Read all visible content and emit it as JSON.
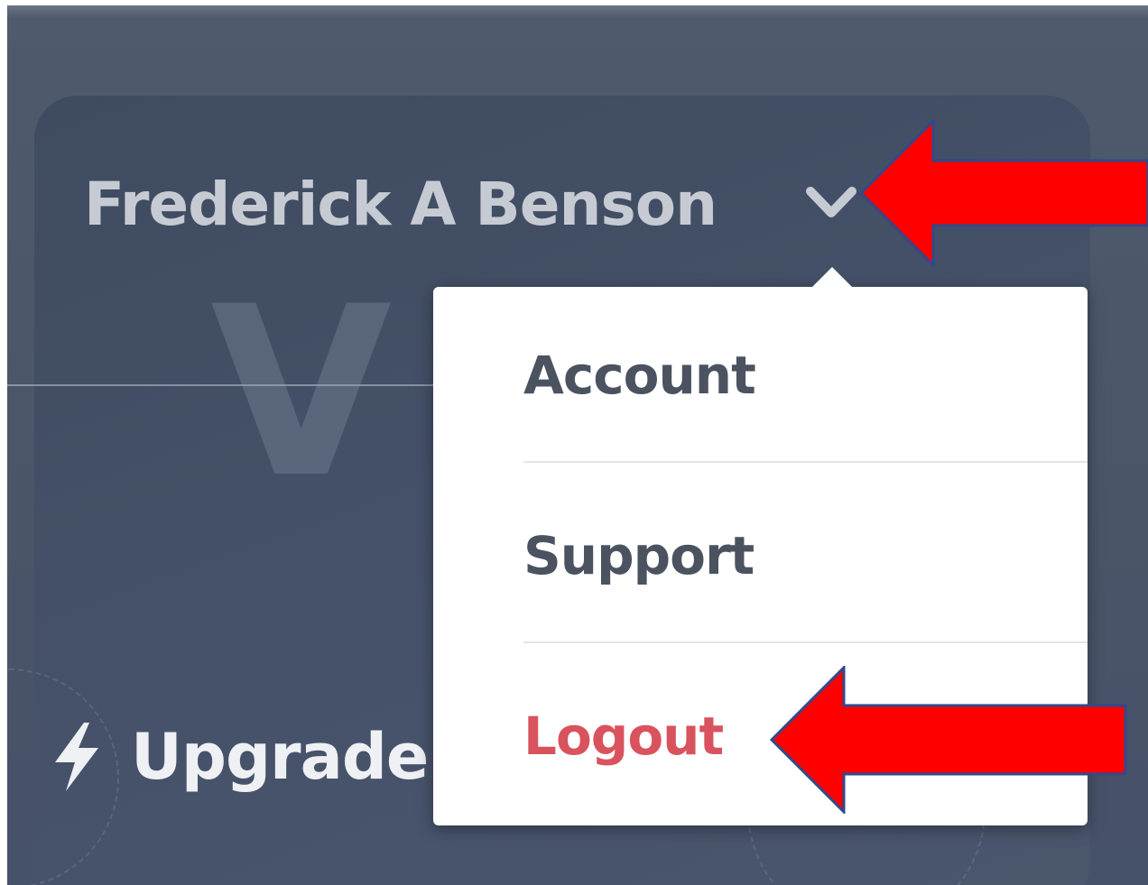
{
  "user_menu": {
    "user_name": "Frederick A Benson",
    "toggle_icon": "chevron-down-icon"
  },
  "background": {
    "watermark_letter": "V"
  },
  "dropdown": {
    "items": [
      {
        "label": "Account",
        "style": "default"
      },
      {
        "label": "Support",
        "style": "default"
      },
      {
        "label": "Logout",
        "style": "danger"
      }
    ]
  },
  "upgrade": {
    "icon": "lightning-icon",
    "label": "Upgrade"
  },
  "annotations": {
    "arrow_color": "#ff0000",
    "arrow_outline": "#2f4a8a",
    "targets": [
      "chevron-down-icon",
      "logout"
    ]
  },
  "colors": {
    "background": "#4a5568",
    "name_text": "#c6cbd3",
    "menu_text": "#4b5260",
    "danger_text": "#d9535e",
    "menu_bg": "#ffffff"
  }
}
